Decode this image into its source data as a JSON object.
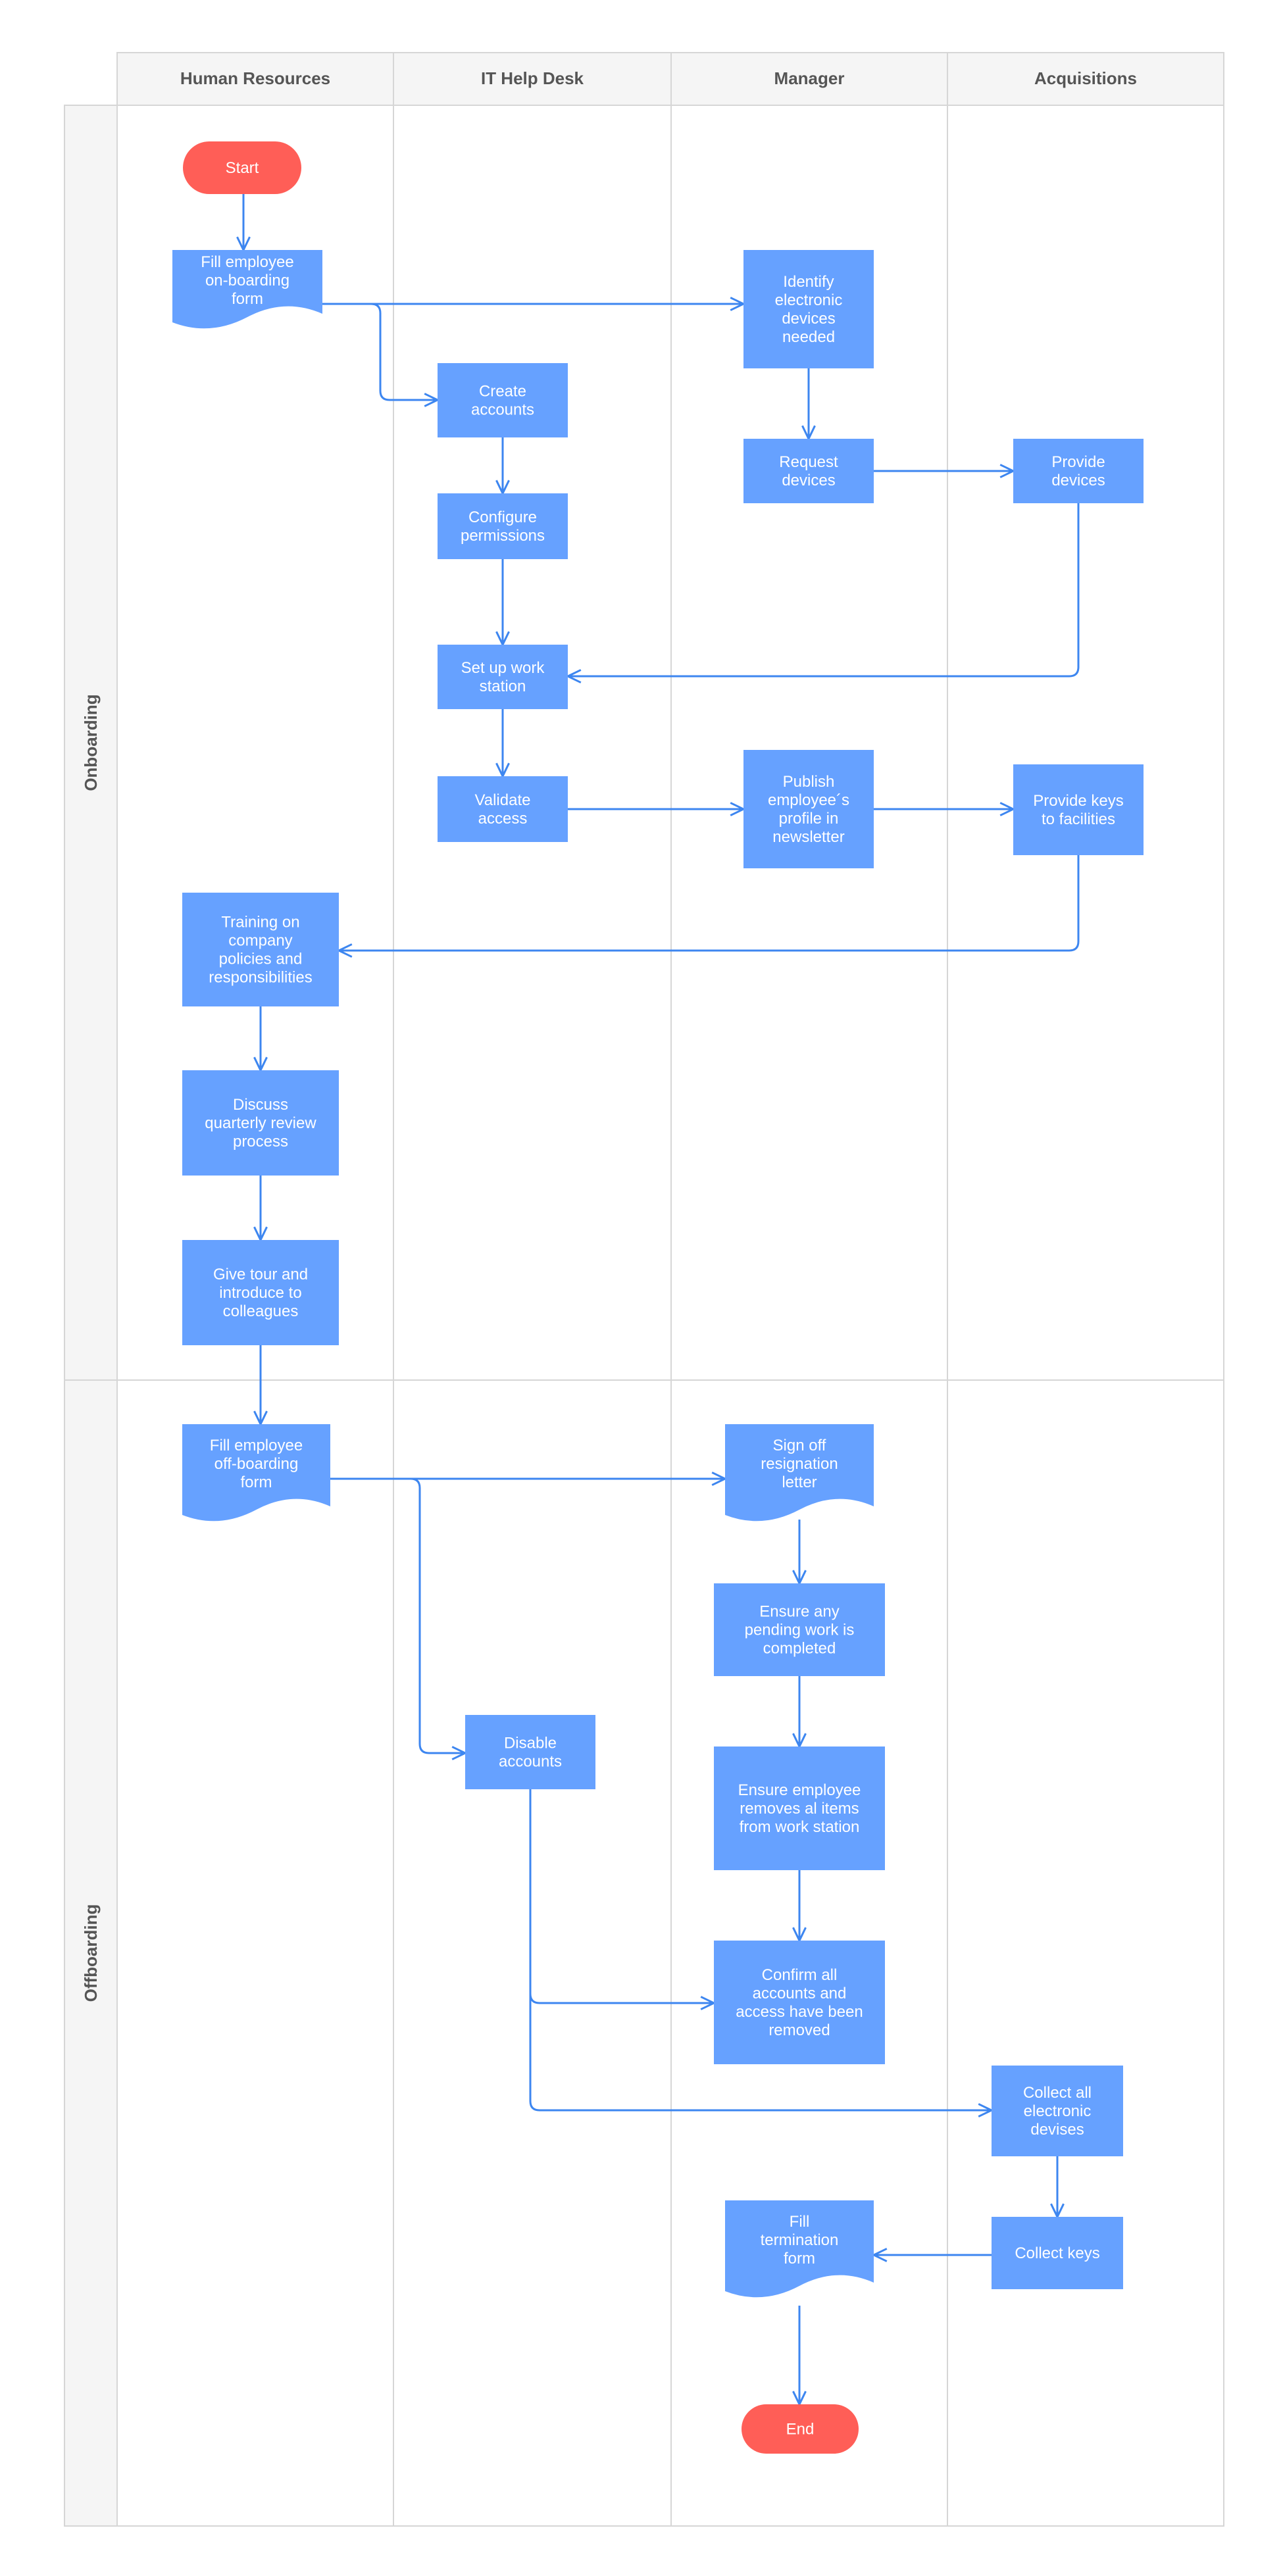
{
  "columns": [
    "Human Resources",
    "IT Help Desk",
    "Manager",
    "Acquisitions"
  ],
  "rows": [
    "Onboarding",
    "Offboarding"
  ],
  "colors": {
    "process": "#66a1ff",
    "terminator": "#ff5e57",
    "connector": "#3d86f0",
    "lane_border": "#d6d6d6",
    "header_bg": "#f5f5f5",
    "header_text": "#555555"
  },
  "nodes": [
    {
      "id": "start",
      "shape": "terminator",
      "lines": [
        "Start"
      ]
    },
    {
      "id": "fill_onboarding",
      "shape": "document",
      "lines": [
        "Fill employee",
        "on-boarding",
        "form"
      ]
    },
    {
      "id": "identify_devices",
      "shape": "process",
      "lines": [
        "Identify",
        "electronic",
        "devices",
        "needed"
      ]
    },
    {
      "id": "create_accounts",
      "shape": "process",
      "lines": [
        "Create",
        "accounts"
      ]
    },
    {
      "id": "request_devices",
      "shape": "process",
      "lines": [
        "Request",
        "devices"
      ]
    },
    {
      "id": "provide_devices",
      "shape": "process",
      "lines": [
        "Provide",
        "devices"
      ]
    },
    {
      "id": "configure_permissions",
      "shape": "process",
      "lines": [
        "Configure",
        "permissions"
      ]
    },
    {
      "id": "setup_workstation",
      "shape": "process",
      "lines": [
        "Set up work",
        "station"
      ]
    },
    {
      "id": "validate_access",
      "shape": "process",
      "lines": [
        "Validate",
        "access"
      ]
    },
    {
      "id": "publish_profile",
      "shape": "process",
      "lines": [
        "Publish",
        "employee´s",
        "profile in",
        "newsletter"
      ]
    },
    {
      "id": "provide_keys",
      "shape": "process",
      "lines": [
        "Provide keys",
        "to facilities"
      ]
    },
    {
      "id": "training",
      "shape": "process",
      "lines": [
        "Training on",
        "company",
        "policies and",
        "responsibilities"
      ]
    },
    {
      "id": "discuss_review",
      "shape": "process",
      "lines": [
        "Discuss",
        "quarterly review",
        "process"
      ]
    },
    {
      "id": "give_tour",
      "shape": "process",
      "lines": [
        "Give tour and",
        "introduce to",
        "colleagues"
      ]
    },
    {
      "id": "fill_offboarding",
      "shape": "document",
      "lines": [
        "Fill employee",
        "off-boarding",
        "form"
      ]
    },
    {
      "id": "sign_off",
      "shape": "document",
      "lines": [
        "Sign off",
        "resignation",
        "letter"
      ]
    },
    {
      "id": "ensure_pending",
      "shape": "process",
      "lines": [
        "Ensure any",
        "pending work is",
        "completed"
      ]
    },
    {
      "id": "disable_accounts",
      "shape": "process",
      "lines": [
        "Disable",
        "accounts"
      ]
    },
    {
      "id": "ensure_removes",
      "shape": "process",
      "lines": [
        "Ensure employee",
        "removes al items",
        "from work station"
      ]
    },
    {
      "id": "confirm_removed",
      "shape": "process",
      "lines": [
        "Confirm all",
        "accounts and",
        "access have been",
        "removed"
      ]
    },
    {
      "id": "collect_devices",
      "shape": "process",
      "lines": [
        "Collect all",
        "electronic",
        "devises"
      ]
    },
    {
      "id": "collect_keys",
      "shape": "process",
      "lines": [
        "Collect keys"
      ]
    },
    {
      "id": "termination_form",
      "shape": "document",
      "lines": [
        "Fill",
        "termination",
        "form"
      ]
    },
    {
      "id": "end",
      "shape": "terminator",
      "lines": [
        "End"
      ]
    }
  ],
  "edges": [
    {
      "from": "start",
      "to": "fill_onboarding"
    },
    {
      "from": "fill_onboarding",
      "to": "identify_devices"
    },
    {
      "from": "fill_onboarding",
      "to": "create_accounts"
    },
    {
      "from": "create_accounts",
      "to": "configure_permissions"
    },
    {
      "from": "configure_permissions",
      "to": "setup_workstation"
    },
    {
      "from": "setup_workstation",
      "to": "validate_access"
    },
    {
      "from": "identify_devices",
      "to": "request_devices"
    },
    {
      "from": "request_devices",
      "to": "provide_devices"
    },
    {
      "from": "provide_devices",
      "to": "setup_workstation"
    },
    {
      "from": "validate_access",
      "to": "publish_profile"
    },
    {
      "from": "publish_profile",
      "to": "provide_keys"
    },
    {
      "from": "provide_keys",
      "to": "training"
    },
    {
      "from": "training",
      "to": "discuss_review"
    },
    {
      "from": "discuss_review",
      "to": "give_tour"
    },
    {
      "from": "give_tour",
      "to": "fill_offboarding"
    },
    {
      "from": "fill_offboarding",
      "to": "sign_off"
    },
    {
      "from": "fill_offboarding",
      "to": "disable_accounts"
    },
    {
      "from": "sign_off",
      "to": "ensure_pending"
    },
    {
      "from": "ensure_pending",
      "to": "ensure_removes"
    },
    {
      "from": "ensure_removes",
      "to": "confirm_removed"
    },
    {
      "from": "disable_accounts",
      "to": "confirm_removed"
    },
    {
      "from": "disable_accounts",
      "to": "collect_devices"
    },
    {
      "from": "collect_devices",
      "to": "collect_keys"
    },
    {
      "from": "collect_keys",
      "to": "termination_form"
    },
    {
      "from": "termination_form",
      "to": "end"
    }
  ]
}
